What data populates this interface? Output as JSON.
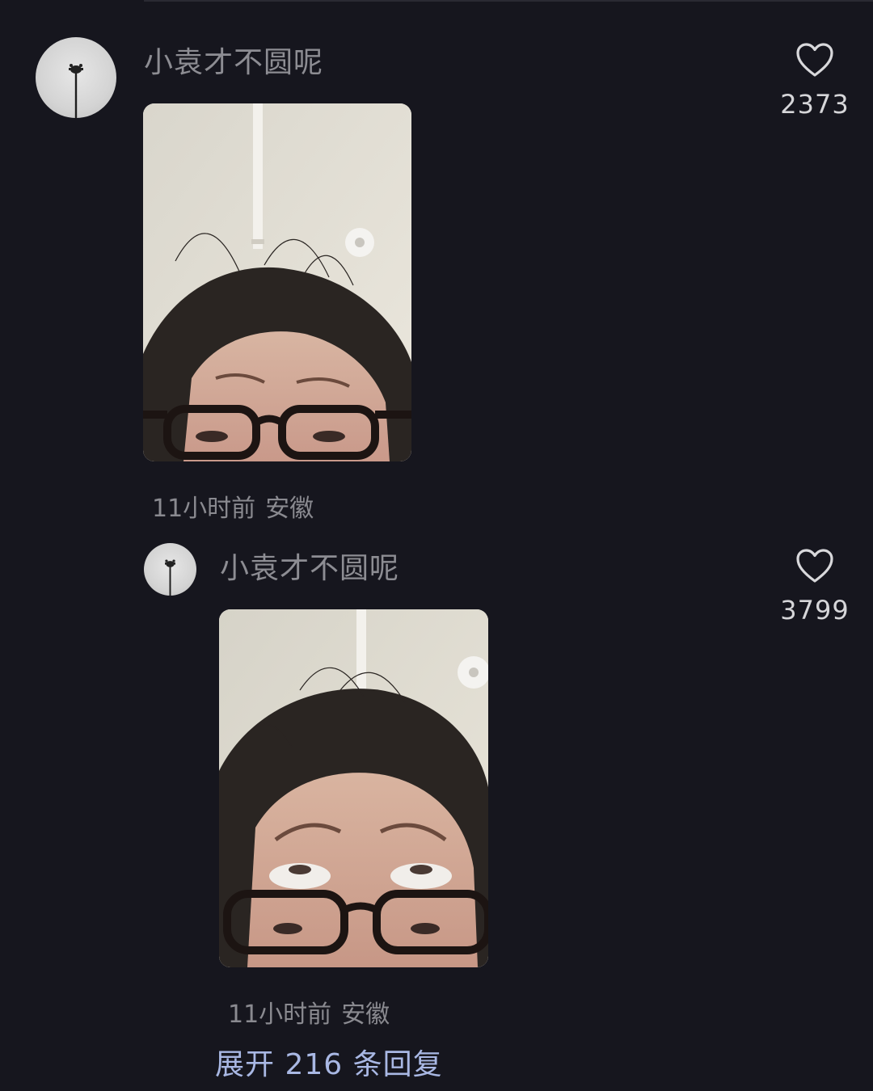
{
  "comments": [
    {
      "username": "小袁才不圆呢",
      "like_count": "2373",
      "time": "11小时前",
      "location": "安徽",
      "avatar_icon": "lamp-post-avatar",
      "photo": "selfie-frowning"
    },
    {
      "username": "小袁才不圆呢",
      "like_count": "3799",
      "time": "11小时前",
      "location": "安徽",
      "avatar_icon": "lamp-post-avatar",
      "photo": "selfie-eyes-rolled"
    }
  ],
  "expand_replies": "展开 216 条回复",
  "colors": {
    "background": "#16161e",
    "username": "#8d8d93",
    "meta": "#8a8a90",
    "link": "#a9b8e4"
  }
}
